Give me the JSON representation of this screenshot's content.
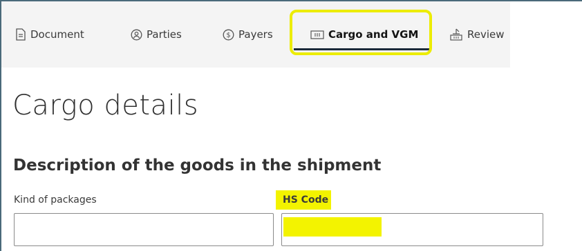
{
  "tabs": [
    {
      "label": "Document",
      "icon": "document-icon"
    },
    {
      "label": "Parties",
      "icon": "parties-icon"
    },
    {
      "label": "Payers",
      "icon": "payers-icon"
    },
    {
      "label": "Cargo and VGM",
      "icon": "container-icon",
      "active": true
    },
    {
      "label": "Review",
      "icon": "review-icon"
    }
  ],
  "page": {
    "title": "Cargo details",
    "subtitle": "Description of the goods in the shipment"
  },
  "fields": {
    "kind_of_packages": {
      "label": "Kind of packages",
      "value": ""
    },
    "hs_code": {
      "label": "HS Code",
      "value": ""
    }
  },
  "colors": {
    "highlight": "#f3f300",
    "active_underline": "#1b2a3a"
  }
}
